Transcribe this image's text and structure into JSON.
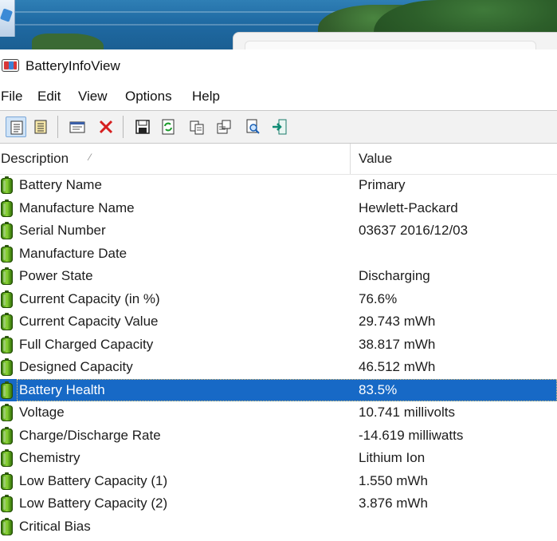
{
  "window": {
    "title": "BatteryInfoView"
  },
  "menu": {
    "items": [
      "File",
      "Edit",
      "View",
      "Options",
      "Help"
    ]
  },
  "toolbar": {
    "buttons": [
      {
        "icon": "html-report-all-icon"
      },
      {
        "icon": "html-report-selected-icon"
      },
      {
        "icon": "properties-icon"
      },
      {
        "icon": "delete-icon"
      },
      {
        "icon": "save-icon"
      },
      {
        "icon": "refresh-icon"
      },
      {
        "icon": "copy-icon"
      },
      {
        "icon": "copy-properties-icon"
      },
      {
        "icon": "find-icon"
      },
      {
        "icon": "exit-icon"
      }
    ]
  },
  "list": {
    "columns": {
      "description": "Description",
      "value": "Value"
    },
    "sort_indicator": "⁄",
    "selected_row": 9,
    "rows": [
      {
        "description": "Battery Name",
        "value": "Primary"
      },
      {
        "description": "Manufacture Name",
        "value": "Hewlett-Packard"
      },
      {
        "description": "Serial Number",
        "value": "03637 2016/12/03"
      },
      {
        "description": "Manufacture Date",
        "value": ""
      },
      {
        "description": "Power State",
        "value": "Discharging"
      },
      {
        "description": "Current Capacity (in %)",
        "value": "76.6%"
      },
      {
        "description": "Current Capacity Value",
        "value": "29.743 mWh"
      },
      {
        "description": "Full Charged Capacity",
        "value": "38.817 mWh"
      },
      {
        "description": "Designed Capacity",
        "value": "46.512 mWh"
      },
      {
        "description": "Battery Health",
        "value": "83.5%"
      },
      {
        "description": "Voltage",
        "value": "10.741 millivolts"
      },
      {
        "description": "Charge/Discharge Rate",
        "value": "-14.619 milliwatts"
      },
      {
        "description": "Chemistry",
        "value": "Lithium Ion"
      },
      {
        "description": "Low Battery Capacity (1)",
        "value": "1.550 mWh"
      },
      {
        "description": "Low Battery Capacity (2)",
        "value": "3.876 mWh"
      },
      {
        "description": "Critical Bias",
        "value": ""
      }
    ]
  }
}
